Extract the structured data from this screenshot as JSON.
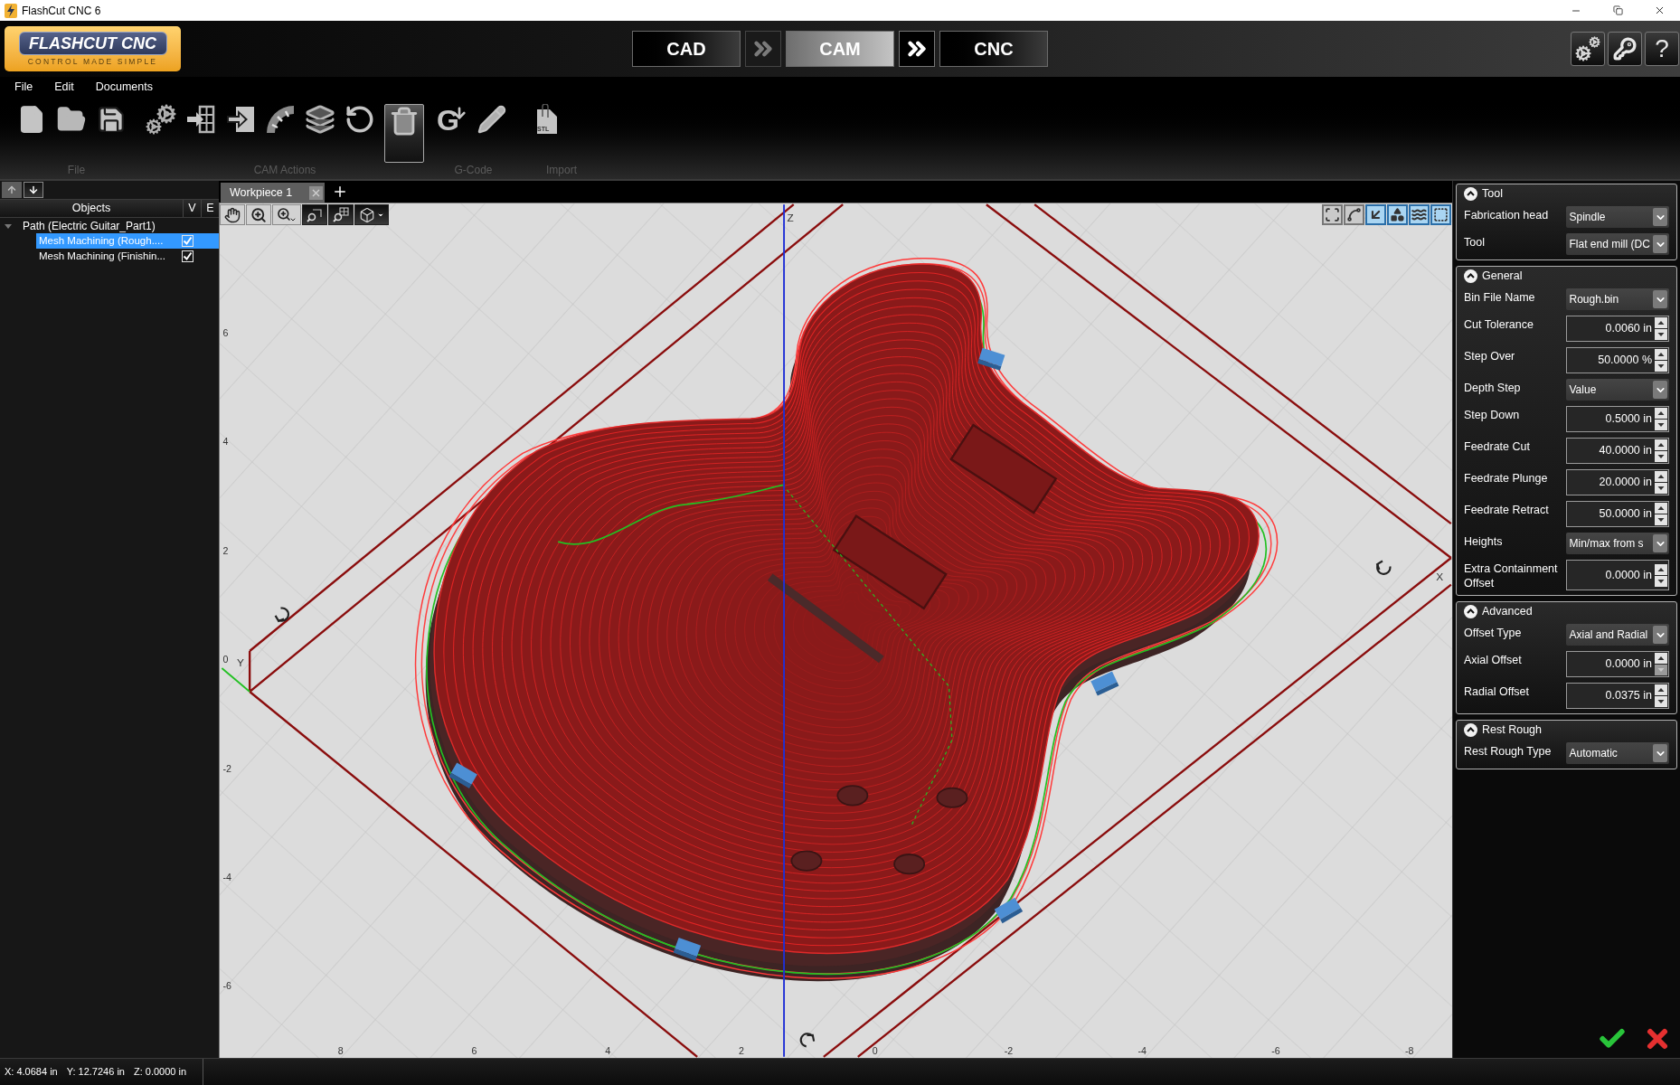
{
  "window": {
    "title": "FlashCut CNC 6"
  },
  "logo": {
    "wordmark": "FLASHCUT CNC",
    "tagline": "CONTROL MADE SIMPLE"
  },
  "mode_tabs": [
    {
      "label": "CAD",
      "selected": false
    },
    {
      "label": "CAM",
      "selected": true
    },
    {
      "label": "CNC",
      "selected": false
    }
  ],
  "mode_arrows": [
    {
      "disabled": true
    },
    {
      "disabled": false
    }
  ],
  "header_buttons": [
    {
      "kind": "settings"
    },
    {
      "kind": "key"
    },
    {
      "kind": "help",
      "label": "?"
    }
  ],
  "menu": [
    "File",
    "Edit",
    "Documents"
  ],
  "toolbar_groups": [
    {
      "label": "File",
      "tools": [
        {
          "kind": "new",
          "highlighted": false
        },
        {
          "kind": "open",
          "highlighted": false
        },
        {
          "kind": "save",
          "highlighted": false
        }
      ]
    },
    {
      "label": "CAM Actions",
      "tools": [
        {
          "kind": "settings",
          "highlighted": false
        },
        {
          "kind": "insert",
          "highlighted": false
        },
        {
          "kind": "export",
          "highlighted": false
        },
        {
          "kind": "arc",
          "highlighted": false
        },
        {
          "kind": "stack",
          "highlighted": false
        },
        {
          "kind": "undo",
          "highlighted": false
        },
        {
          "kind": "delete",
          "highlighted": true
        }
      ]
    },
    {
      "label": "G-Code",
      "tools": [
        {
          "kind": "generate",
          "glyph": "G",
          "highlighted": false
        },
        {
          "kind": "edit",
          "highlighted": false
        }
      ]
    },
    {
      "label": "Import",
      "tools": [
        {
          "kind": "stl",
          "glyph": "STL",
          "highlighted": false
        }
      ]
    }
  ],
  "objects_panel": {
    "order_buttons": [
      {
        "kind": "up",
        "disabled": true
      },
      {
        "kind": "down",
        "disabled": false
      }
    ],
    "columns": [
      "Objects",
      "V",
      "E"
    ],
    "tree": [
      {
        "label": "Path (Electric Guitar_Part1)",
        "expanded": true,
        "children": [
          {
            "label": "Mesh Machining (Rough....",
            "selected": true,
            "checked": true
          },
          {
            "label": "Mesh Machining (Finishin...",
            "selected": false,
            "checked": true
          }
        ]
      }
    ]
  },
  "document_tabs": [
    {
      "label": "Workpiece 1",
      "selected": true
    }
  ],
  "view_tools": [
    {
      "kind": "pan",
      "active": true
    },
    {
      "kind": "zoom",
      "active": true
    },
    {
      "kind": "zoom_menu",
      "active": true
    },
    {
      "kind": "zoom_window",
      "active": false
    },
    {
      "kind": "zoom_grid",
      "active": false
    },
    {
      "kind": "view_cube",
      "active": false
    }
  ],
  "view_modes": [
    {
      "kind": "fit",
      "active": false
    },
    {
      "kind": "spline",
      "active": false
    },
    {
      "kind": "arrow",
      "active": true
    },
    {
      "kind": "shapes",
      "active": true
    },
    {
      "kind": "curve",
      "active": true
    },
    {
      "kind": "frame",
      "active": true
    }
  ],
  "viewport": {
    "axis_names": {
      "z": "Z",
      "y": "Y",
      "x": "X"
    },
    "y_labels": [
      "6",
      "4",
      "2",
      "0",
      "-2",
      "-4",
      "-6"
    ],
    "x_labels": [
      "8",
      "6",
      "4",
      "2",
      "0",
      "-2",
      "-4",
      "-6",
      "-8"
    ]
  },
  "properties": [
    {
      "title": "Tool",
      "expanded": true,
      "rows": [
        {
          "label": "Fabrication head",
          "kind": "dropdown",
          "value": "Spindle"
        },
        {
          "label": "Tool",
          "kind": "dropdown",
          "value": "Flat end mill (DC"
        }
      ]
    },
    {
      "title": "General",
      "expanded": true,
      "rows": [
        {
          "label": "Bin File Name",
          "kind": "dropdown",
          "value": "Rough.bin"
        },
        {
          "label": "Cut Tolerance",
          "kind": "spin",
          "value": "0.0060 in",
          "decrement_disabled": false
        },
        {
          "label": "Step Over",
          "kind": "spin",
          "value": "50.0000 %",
          "decrement_disabled": false
        },
        {
          "label": "Depth Step",
          "kind": "dropdown",
          "value": "Value"
        },
        {
          "label": "Step Down",
          "kind": "spin",
          "value": "0.5000 in",
          "decrement_disabled": false
        },
        {
          "label": "Feedrate Cut",
          "kind": "spin",
          "value": "40.0000 in",
          "decrement_disabled": false
        },
        {
          "label": "Feedrate Plunge",
          "kind": "spin",
          "value": "20.0000 in",
          "decrement_disabled": false
        },
        {
          "label": "Feedrate Retract",
          "kind": "spin",
          "value": "50.0000 in",
          "decrement_disabled": false
        },
        {
          "label": "Heights",
          "kind": "dropdown",
          "value": "Min/max from s"
        },
        {
          "label": "Extra Containment Offset",
          "kind": "spin",
          "value": "0.0000 in",
          "decrement_disabled": false
        }
      ]
    },
    {
      "title": "Advanced",
      "expanded": true,
      "rows": [
        {
          "label": "Offset Type",
          "kind": "dropdown",
          "value": "Axial and Radial"
        },
        {
          "label": "Axial Offset",
          "kind": "spin",
          "value": "0.0000 in",
          "decrement_disabled": true
        },
        {
          "label": "Radial Offset",
          "kind": "spin",
          "value": "0.0375 in",
          "decrement_disabled": false
        }
      ]
    },
    {
      "title": "Rest Rough",
      "expanded": true,
      "rows": [
        {
          "label": "Rest Rough Type",
          "kind": "dropdown",
          "value": "Automatic"
        }
      ]
    }
  ],
  "actions": [
    {
      "kind": "accept"
    },
    {
      "kind": "cancel"
    }
  ],
  "status_bar": {
    "coordinates": [
      "X: 4.0684 in",
      "Y: 12.7246 in",
      "Z: 0.0000 in"
    ]
  }
}
